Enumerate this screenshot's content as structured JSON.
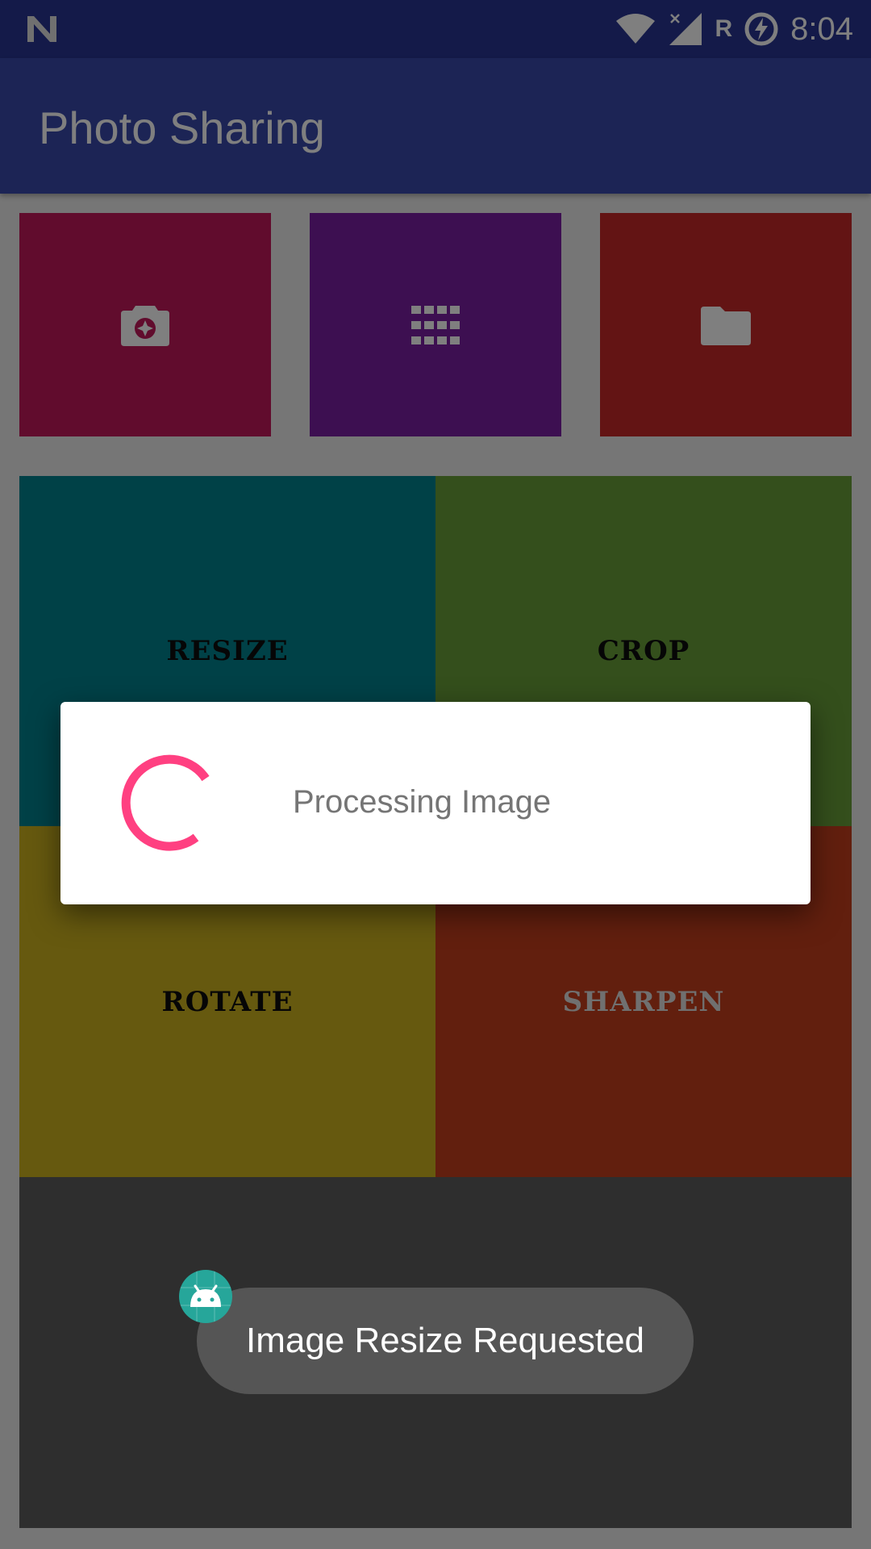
{
  "status_bar": {
    "logo_icon": "n-logo-icon",
    "icons": [
      "wifi-icon",
      "cell-signal-off-icon",
      "battery-charging-icon"
    ],
    "roaming_label": "R",
    "time": "8:04"
  },
  "app_bar": {
    "title": "Photo Sharing"
  },
  "source_tiles": [
    {
      "icon": "camera-icon",
      "color": "#c2185b"
    },
    {
      "icon": "grid-icon",
      "color": "#7b1fa2"
    },
    {
      "icon": "folder-icon",
      "color": "#c62828"
    }
  ],
  "operations": [
    {
      "label": "RESIZE",
      "color": "#00838f"
    },
    {
      "label": "CROP",
      "color": "#689f38"
    },
    {
      "label": "ROTATE",
      "color": "#cdb21f"
    },
    {
      "label": "SHARPEN",
      "color": "#c43f1c"
    }
  ],
  "progress_dialog": {
    "message": "Processing Image",
    "spinner_color": "#ff4081"
  },
  "toast": {
    "message": "Image Resize Requested",
    "icon": "android-icon"
  },
  "colors": {
    "status_bar": "#283593",
    "app_bar": "#3949ab",
    "scrim": "rgba(0,0,0,0.5)"
  }
}
